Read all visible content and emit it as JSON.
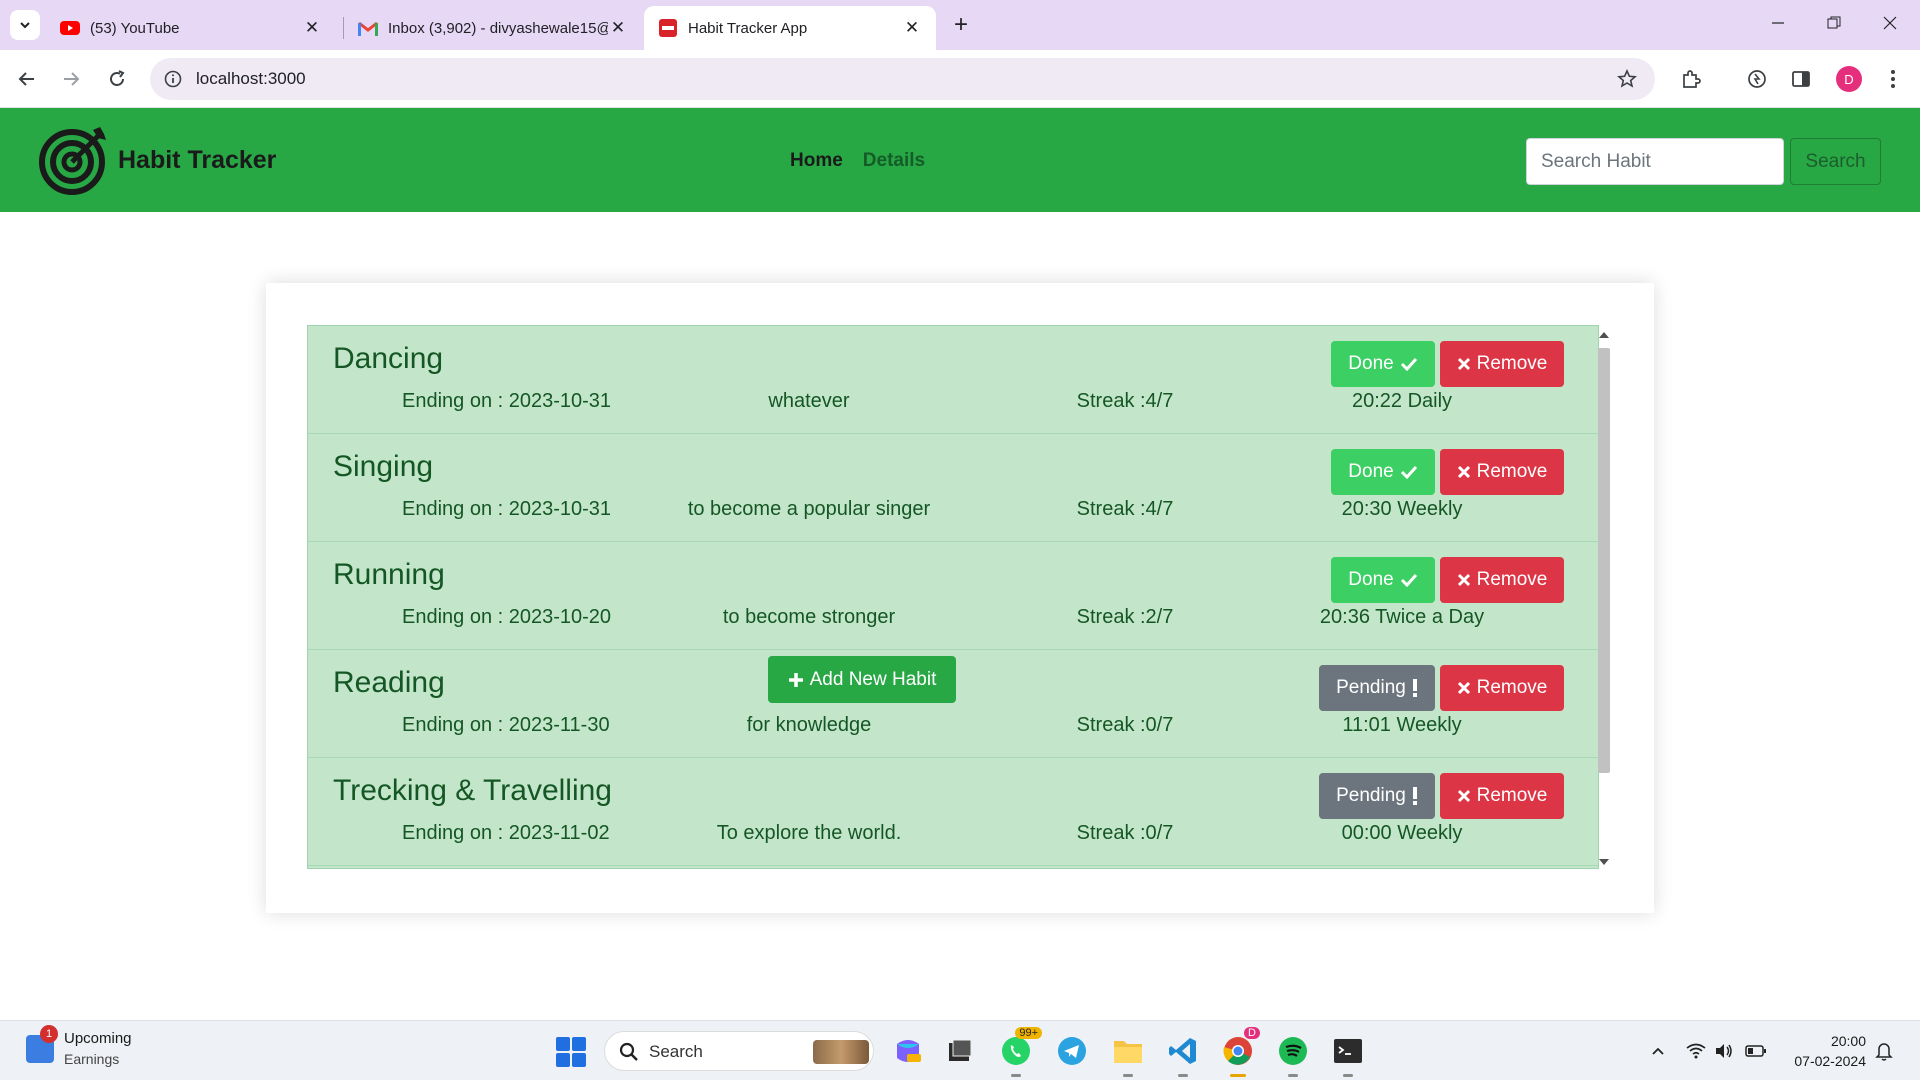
{
  "browser": {
    "tabs": [
      {
        "title": "(53) YouTube",
        "icon": "youtube-icon"
      },
      {
        "title": "Inbox (3,902) - divyashewale15@",
        "icon": "gmail-icon"
      },
      {
        "title": "Habit Tracker App",
        "icon": "habit-tracker-favicon"
      }
    ],
    "url": "localhost:3000",
    "profile_initial": "D"
  },
  "app": {
    "brand": "Habit Tracker",
    "nav": {
      "home": "Home",
      "details": "Details"
    },
    "search": {
      "placeholder": "Search Habit",
      "button": "Search"
    },
    "add_button": "Add New Habit",
    "habits": [
      {
        "name": "Dancing",
        "ending": "Ending on : 2023-10-31",
        "description": "whatever",
        "streak": "Streak :4/7",
        "time": "20:22 Daily",
        "status": "Done",
        "remove": "Remove"
      },
      {
        "name": "Singing",
        "ending": "Ending on : 2023-10-31",
        "description": "to become a popular singer",
        "streak": "Streak :4/7",
        "time": "20:30 Weekly",
        "status": "Done",
        "remove": "Remove"
      },
      {
        "name": "Running",
        "ending": "Ending on : 2023-10-20",
        "description": "to become stronger",
        "streak": "Streak :2/7",
        "time": "20:36 Twice a Day",
        "status": "Done",
        "remove": "Remove"
      },
      {
        "name": "Reading",
        "ending": "Ending on : 2023-11-30",
        "description": "for knowledge",
        "streak": "Streak :0/7",
        "time": "11:01 Weekly",
        "status": "Pending",
        "remove": "Remove"
      },
      {
        "name": "Trecking & Travelling",
        "ending": "Ending on : 2023-11-02",
        "description": "To explore the world.",
        "streak": "Streak :0/7",
        "time": "00:00 Weekly",
        "status": "Pending",
        "remove": "Remove"
      }
    ]
  },
  "taskbar": {
    "widget": {
      "title": "Upcoming",
      "subtitle": "Earnings",
      "badge": "1"
    },
    "search_label": "Search",
    "whatsapp_badge": "99+",
    "chrome_badge": "D",
    "time": "20:00",
    "date": "07-02-2024"
  },
  "colors": {
    "navbar": "#28a745",
    "list_bg": "#c3e6cb",
    "done": "#3ccf63",
    "pending": "#6c757d",
    "remove": "#dc3545"
  }
}
